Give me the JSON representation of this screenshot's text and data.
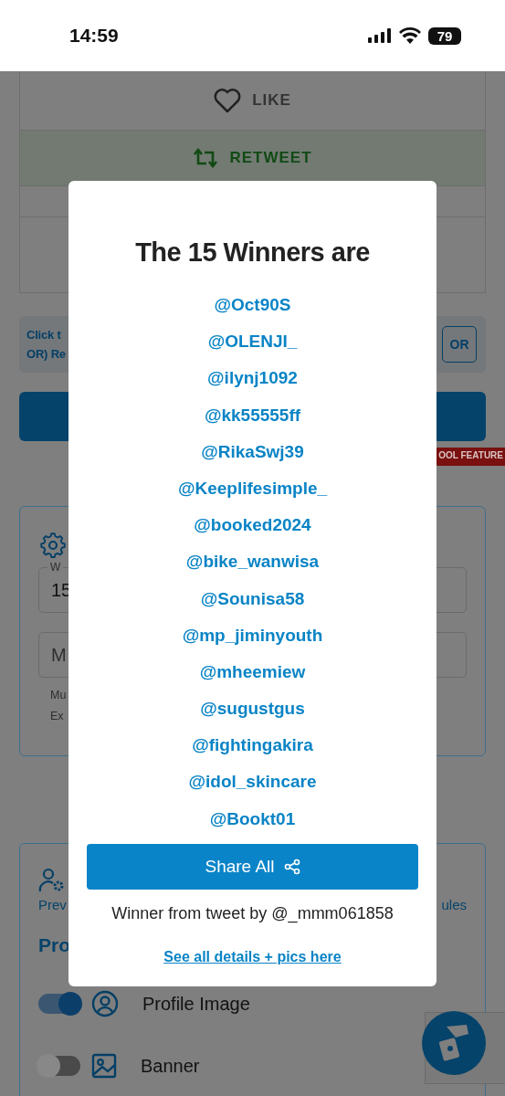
{
  "status_bar": {
    "time": "14:59",
    "battery": "79"
  },
  "background": {
    "like_button": "LIKE",
    "retweet_button": "RETWEET",
    "notice": {
      "lines": [
        "Click t",
        "OR) Re"
      ],
      "button": "OR"
    },
    "badge": "OOL FEATURE",
    "settings_card": {
      "field_1": {
        "label": "W",
        "value": "15"
      },
      "field_2": {
        "placeholder": "M"
      },
      "helper_lines": [
        "Mu",
        "Ex"
      ]
    },
    "preview_card": {
      "tab_left": "Prev",
      "tab_right": "ules",
      "heading": "Pro",
      "toggles": [
        {
          "kind": "profile",
          "label": "Profile Image",
          "on": true
        },
        {
          "kind": "image",
          "label": "Banner",
          "on": false
        }
      ]
    }
  },
  "modal": {
    "title": "The 15 Winners are",
    "winners": [
      "@Oct90S",
      "@OLENJI_",
      "@ilynj1092",
      "@kk55555ff",
      "@RikaSwj39",
      "@Keeplifesimple_",
      "@booked2024",
      "@bike_wanwisa",
      "@Sounisa58",
      "@mp_jiminyouth",
      "@mheemiew",
      "@sugustgus",
      "@fightingakira",
      "@idol_skincare",
      "@Bookt01"
    ],
    "share_button": "Share All",
    "source_text": "Winner from tweet by @_mmm061858",
    "details_link": "See all details + pics here"
  }
}
